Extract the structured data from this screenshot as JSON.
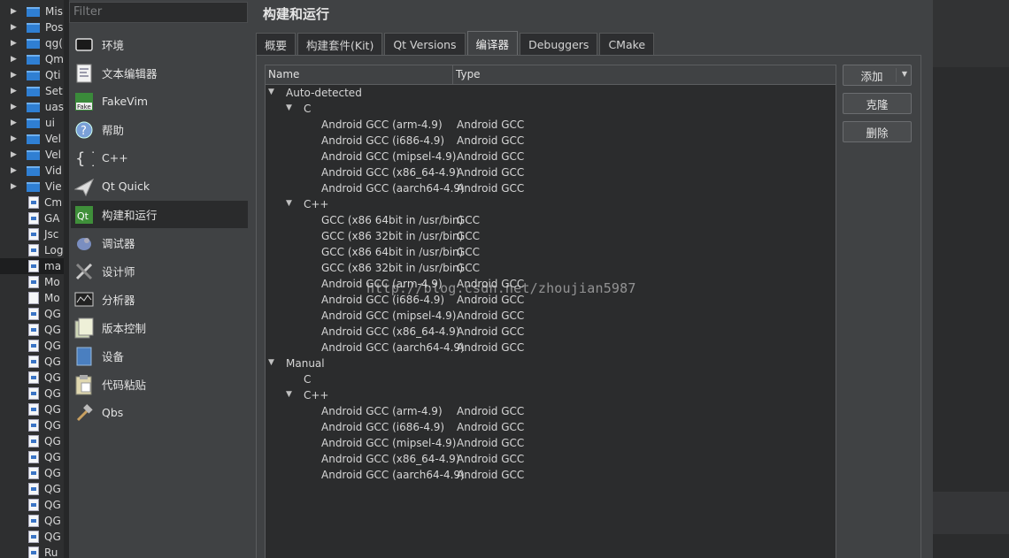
{
  "project_tree": [
    {
      "label": "Mis",
      "type": "folder",
      "expandable": true
    },
    {
      "label": "Pos",
      "type": "folder",
      "expandable": true
    },
    {
      "label": "qg(",
      "type": "folder",
      "expandable": true
    },
    {
      "label": "Qm",
      "type": "folder",
      "expandable": true
    },
    {
      "label": "Qti",
      "type": "folder",
      "expandable": true
    },
    {
      "label": "Set",
      "type": "folder",
      "expandable": true
    },
    {
      "label": "uas",
      "type": "folder",
      "expandable": true
    },
    {
      "label": "ui",
      "type": "folder",
      "expandable": true
    },
    {
      "label": "Vel",
      "type": "folder",
      "expandable": true
    },
    {
      "label": "Vel",
      "type": "folder",
      "expandable": true
    },
    {
      "label": "Vid",
      "type": "folder",
      "expandable": true
    },
    {
      "label": "Vie",
      "type": "folder",
      "expandable": true
    },
    {
      "label": "Cm",
      "type": "file",
      "expandable": false
    },
    {
      "label": "GA",
      "type": "file",
      "expandable": false
    },
    {
      "label": "Jsc",
      "type": "file",
      "expandable": false
    },
    {
      "label": "Log",
      "type": "file",
      "expandable": false
    },
    {
      "label": "ma",
      "type": "file",
      "expandable": false,
      "selected": true
    },
    {
      "label": "Mo",
      "type": "file",
      "expandable": false
    },
    {
      "label": "Mo",
      "type": "plain",
      "expandable": false
    },
    {
      "label": "QG",
      "type": "file",
      "expandable": false
    },
    {
      "label": "QG",
      "type": "file",
      "expandable": false
    },
    {
      "label": "QG",
      "type": "file",
      "expandable": false
    },
    {
      "label": "QG",
      "type": "file",
      "expandable": false
    },
    {
      "label": "QG",
      "type": "file",
      "expandable": false
    },
    {
      "label": "QG",
      "type": "file",
      "expandable": false
    },
    {
      "label": "QG",
      "type": "file",
      "expandable": false
    },
    {
      "label": "QG",
      "type": "file",
      "expandable": false
    },
    {
      "label": "QG",
      "type": "file",
      "expandable": false
    },
    {
      "label": "QG",
      "type": "file",
      "expandable": false
    },
    {
      "label": "QG",
      "type": "file",
      "expandable": false
    },
    {
      "label": "QG",
      "type": "file",
      "expandable": false
    },
    {
      "label": "QG",
      "type": "file",
      "expandable": false
    },
    {
      "label": "QG",
      "type": "file",
      "expandable": false
    },
    {
      "label": "QG",
      "type": "file",
      "expandable": false
    },
    {
      "label": "Ru",
      "type": "file",
      "expandable": false
    }
  ],
  "filter": {
    "placeholder": "Filter"
  },
  "categories": [
    {
      "label": "环境",
      "icon": "monitor-icon"
    },
    {
      "label": "文本编辑器",
      "icon": "text-editor-icon"
    },
    {
      "label": "FakeVim",
      "icon": "fakevim-icon"
    },
    {
      "label": "帮助",
      "icon": "help-icon"
    },
    {
      "label": "C++",
      "icon": "braces-icon"
    },
    {
      "label": "Qt Quick",
      "icon": "paper-plane-icon"
    },
    {
      "label": "构建和运行",
      "icon": "build-run-icon",
      "active": true
    },
    {
      "label": "调试器",
      "icon": "debugger-icon"
    },
    {
      "label": "设计师",
      "icon": "designer-icon"
    },
    {
      "label": "分析器",
      "icon": "analyzer-icon"
    },
    {
      "label": "版本控制",
      "icon": "version-control-icon"
    },
    {
      "label": "设备",
      "icon": "device-icon"
    },
    {
      "label": "代码粘贴",
      "icon": "code-paste-icon"
    },
    {
      "label": "Qbs",
      "icon": "hammer-icon"
    }
  ],
  "page_title": "构建和运行",
  "tabs": [
    {
      "label": "概要"
    },
    {
      "label": "构建套件(Kit)"
    },
    {
      "label": "Qt Versions"
    },
    {
      "label": "编译器",
      "active": true
    },
    {
      "label": "Debuggers"
    },
    {
      "label": "CMake"
    }
  ],
  "table": {
    "headers": [
      "Name",
      "Type"
    ],
    "rows": [
      {
        "level": 0,
        "expanded": true,
        "name": "Auto-detected",
        "type": ""
      },
      {
        "level": 1,
        "expanded": true,
        "name": "C",
        "type": ""
      },
      {
        "level": 2,
        "name": "Android GCC (arm-4.9)",
        "type": "Android GCC"
      },
      {
        "level": 2,
        "name": "Android GCC (i686-4.9)",
        "type": "Android GCC"
      },
      {
        "level": 2,
        "name": "Android GCC (mipsel-4.9)",
        "type": "Android GCC"
      },
      {
        "level": 2,
        "name": "Android GCC (x86_64-4.9)",
        "type": "Android GCC"
      },
      {
        "level": 2,
        "name": "Android GCC (aarch64-4.9)",
        "type": "Android GCC"
      },
      {
        "level": 1,
        "expanded": true,
        "name": "C++",
        "type": ""
      },
      {
        "level": 2,
        "name": "GCC (x86 64bit in /usr/bin)",
        "type": "GCC"
      },
      {
        "level": 2,
        "name": "GCC (x86 32bit in /usr/bin)",
        "type": "GCC"
      },
      {
        "level": 2,
        "name": "GCC (x86 64bit in /usr/bin)",
        "type": "GCC"
      },
      {
        "level": 2,
        "name": "GCC (x86 32bit in /usr/bin)",
        "type": "GCC"
      },
      {
        "level": 2,
        "name": "Android GCC (arm-4.9)",
        "type": "Android GCC"
      },
      {
        "level": 2,
        "name": "Android GCC (i686-4.9)",
        "type": "Android GCC"
      },
      {
        "level": 2,
        "name": "Android GCC (mipsel-4.9)",
        "type": "Android GCC"
      },
      {
        "level": 2,
        "name": "Android GCC (x86_64-4.9)",
        "type": "Android GCC"
      },
      {
        "level": 2,
        "name": "Android GCC (aarch64-4.9)",
        "type": "Android GCC"
      },
      {
        "level": 0,
        "expanded": true,
        "name": "Manual",
        "type": ""
      },
      {
        "level": 1,
        "expanded": false,
        "leaf": true,
        "name": "C",
        "type": ""
      },
      {
        "level": 1,
        "expanded": true,
        "name": "C++",
        "type": ""
      },
      {
        "level": 2,
        "name": "Android GCC (arm-4.9)",
        "type": "Android GCC"
      },
      {
        "level": 2,
        "name": "Android GCC (i686-4.9)",
        "type": "Android GCC"
      },
      {
        "level": 2,
        "name": "Android GCC (mipsel-4.9)",
        "type": "Android GCC"
      },
      {
        "level": 2,
        "name": "Android GCC (x86_64-4.9)",
        "type": "Android GCC"
      },
      {
        "level": 2,
        "name": "Android GCC (aarch64-4.9)",
        "type": "Android GCC"
      }
    ]
  },
  "buttons": {
    "add": "添加",
    "clone": "克隆",
    "delete": "删除"
  },
  "watermark": "http://blog.csdn.net/zhoujian5987"
}
